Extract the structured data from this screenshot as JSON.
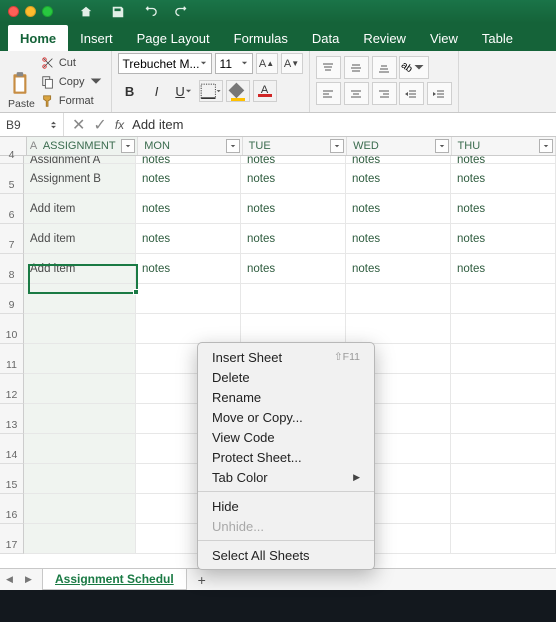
{
  "titlebar_icons": [
    "home",
    "save",
    "undo",
    "redo"
  ],
  "tabs": [
    {
      "label": "Home",
      "active": true
    },
    {
      "label": "Insert"
    },
    {
      "label": "Page Layout"
    },
    {
      "label": "Formulas"
    },
    {
      "label": "Data"
    },
    {
      "label": "Review"
    },
    {
      "label": "View"
    },
    {
      "label": "Table"
    }
  ],
  "clipboard": {
    "paste": "Paste",
    "cut": "Cut",
    "copy": "Copy",
    "format": "Format"
  },
  "font": {
    "name": "Trebuchet M...",
    "size": "11"
  },
  "namebox": "B9",
  "fx": "fx",
  "formula": "Add item",
  "columns": [
    "ASSIGNMENT",
    "MON",
    "TUE",
    "WED",
    "THU"
  ],
  "col0_letter": "A",
  "rows_num": [
    "4",
    "5",
    "6",
    "7",
    "8",
    "9",
    "10",
    "11",
    "12",
    "13",
    "14",
    "15",
    "16",
    "17"
  ],
  "data_rows": [
    {
      "a": "Assignment A",
      "c": [
        "notes",
        "notes",
        "notes",
        "notes"
      ]
    },
    {
      "a": "Assignment B",
      "c": [
        "notes",
        "notes",
        "notes",
        "notes"
      ]
    },
    {
      "a": "Add item",
      "c": [
        "notes",
        "notes",
        "notes",
        "notes"
      ]
    },
    {
      "a": "Add item",
      "c": [
        "notes",
        "notes",
        "notes",
        "notes"
      ]
    },
    {
      "a": "Add item",
      "c": [
        "notes",
        "notes",
        "notes",
        "notes"
      ]
    }
  ],
  "sheet_tab": "Assignment Schedul",
  "context_menu": {
    "insert": "Insert Sheet",
    "insert_key": "⇧F11",
    "delete": "Delete",
    "rename": "Rename",
    "move": "Move or Copy...",
    "view_code": "View Code",
    "protect": "Protect Sheet...",
    "tab_color": "Tab Color",
    "hide": "Hide",
    "unhide": "Unhide...",
    "select_all": "Select All Sheets"
  },
  "colors": {
    "accent": "#1a7a44",
    "fill": "#ffc000",
    "font": "#d02626"
  }
}
